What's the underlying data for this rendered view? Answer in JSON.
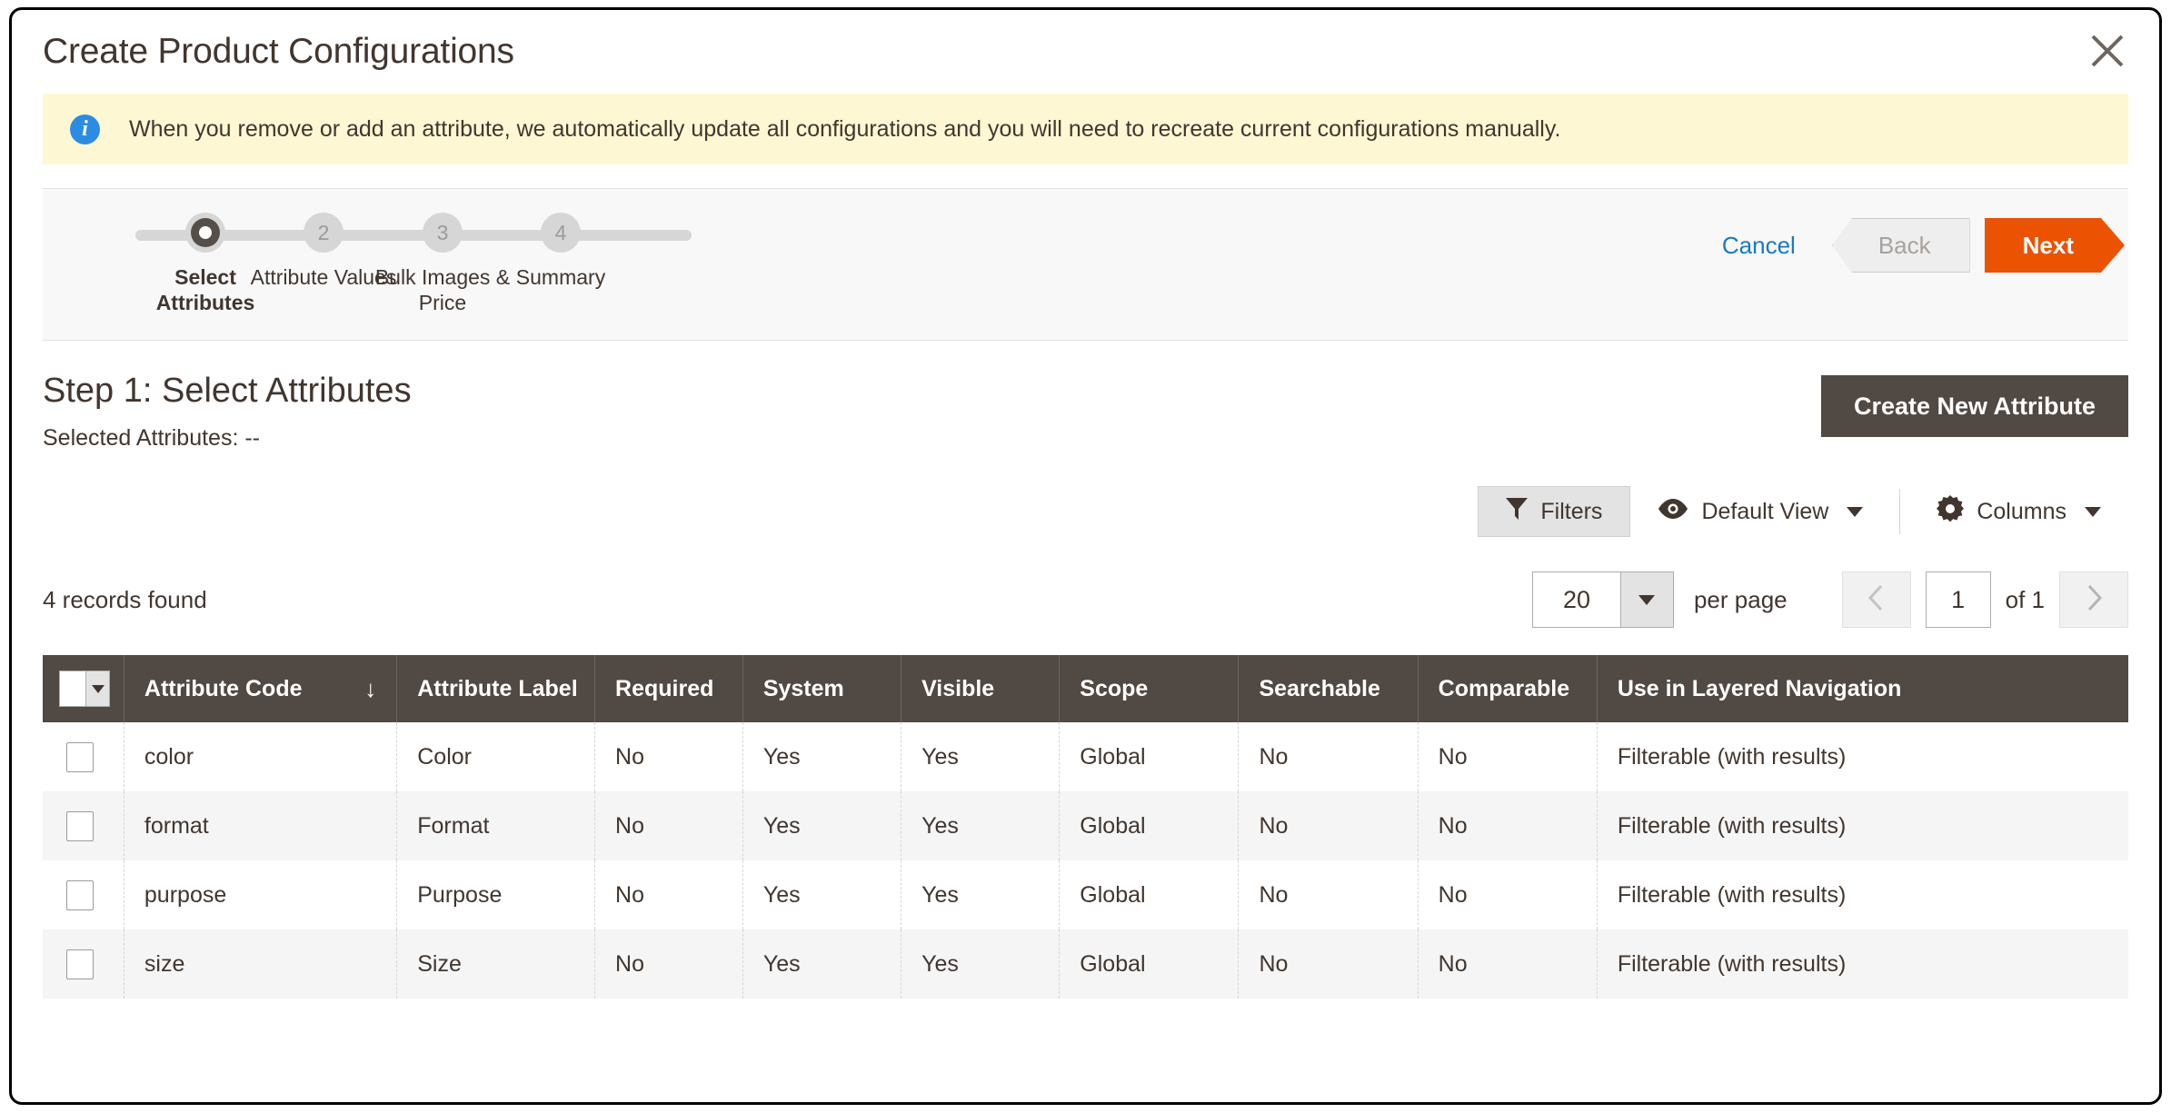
{
  "modal": {
    "title": "Create Product Configurations",
    "close_icon": "close-icon"
  },
  "notice": {
    "icon": "info-icon",
    "text": "When you remove or add an attribute, we automatically update all configurations and you will need to recreate current configurations manually."
  },
  "wizard": {
    "steps": [
      {
        "number": "1",
        "label": "Select Attributes",
        "active": true
      },
      {
        "number": "2",
        "label": "Attribute Values",
        "active": false
      },
      {
        "number": "3",
        "label": "Bulk Images & Price",
        "active": false
      },
      {
        "number": "4",
        "label": "Summary",
        "active": false
      }
    ],
    "cancel_label": "Cancel",
    "back_label": "Back",
    "next_label": "Next"
  },
  "section": {
    "title": "Step 1: Select Attributes",
    "selected_attributes": "Selected Attributes: --",
    "create_attribute_label": "Create New Attribute"
  },
  "toolbar": {
    "filters_label": "Filters",
    "filters_icon": "funnel-icon",
    "view_label": "Default View",
    "view_icon": "eye-icon",
    "columns_label": "Columns",
    "columns_icon": "gear-icon"
  },
  "pager": {
    "records_found": "4 records found",
    "per_page_value": "20",
    "per_page_label": "per page",
    "prev_icon": "chevron-left-icon",
    "next_icon": "chevron-right-icon",
    "page_value": "1",
    "of_label": "of 1"
  },
  "grid": {
    "columns": [
      {
        "key": "check",
        "label": ""
      },
      {
        "key": "code",
        "label": "Attribute Code",
        "sorted": true,
        "sort_icon": "arrow-down-icon"
      },
      {
        "key": "attr_label",
        "label": "Attribute Label"
      },
      {
        "key": "required",
        "label": "Required"
      },
      {
        "key": "system",
        "label": "System"
      },
      {
        "key": "visible",
        "label": "Visible"
      },
      {
        "key": "scope",
        "label": "Scope"
      },
      {
        "key": "searchable",
        "label": "Searchable"
      },
      {
        "key": "comparable",
        "label": "Comparable"
      },
      {
        "key": "layered",
        "label": "Use in Layered Navigation"
      }
    ],
    "rows": [
      {
        "code": "color",
        "attr_label": "Color",
        "required": "No",
        "system": "Yes",
        "visible": "Yes",
        "scope": "Global",
        "searchable": "No",
        "comparable": "No",
        "layered": "Filterable (with results)"
      },
      {
        "code": "format",
        "attr_label": "Format",
        "required": "No",
        "system": "Yes",
        "visible": "Yes",
        "scope": "Global",
        "searchable": "No",
        "comparable": "No",
        "layered": "Filterable (with results)"
      },
      {
        "code": "purpose",
        "attr_label": "Purpose",
        "required": "No",
        "system": "Yes",
        "visible": "Yes",
        "scope": "Global",
        "searchable": "No",
        "comparable": "No",
        "layered": "Filterable (with results)"
      },
      {
        "code": "size",
        "attr_label": "Size",
        "required": "No",
        "system": "Yes",
        "visible": "Yes",
        "scope": "Global",
        "searchable": "No",
        "comparable": "No",
        "layered": "Filterable (with results)"
      }
    ]
  },
  "colors": {
    "accent_orange": "#eb5202",
    "link_blue": "#1979c3",
    "header_brown": "#514943",
    "notice_yellow": "#fdf8d3",
    "info_blue": "#2c8ce3"
  }
}
